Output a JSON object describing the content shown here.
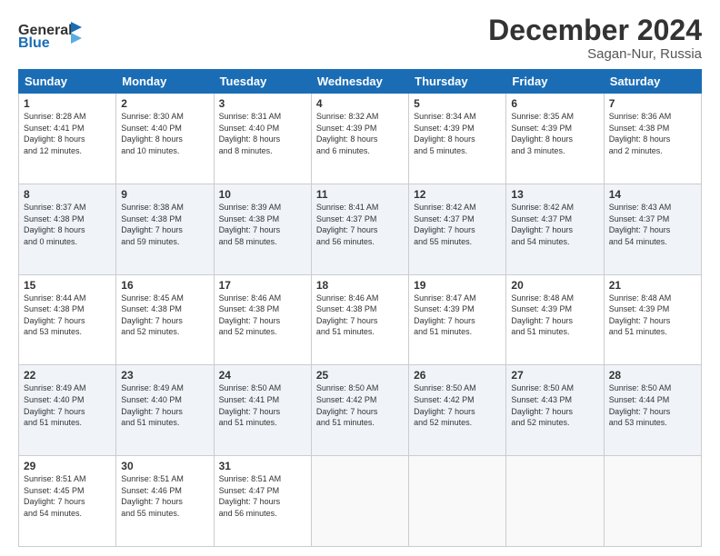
{
  "header": {
    "logo_general": "General",
    "logo_blue": "Blue",
    "month_title": "December 2024",
    "subtitle": "Sagan-Nur, Russia"
  },
  "days_of_week": [
    "Sunday",
    "Monday",
    "Tuesday",
    "Wednesday",
    "Thursday",
    "Friday",
    "Saturday"
  ],
  "weeks": [
    [
      {
        "day": "1",
        "info": "Sunrise: 8:28 AM\nSunset: 4:41 PM\nDaylight: 8 hours\nand 12 minutes."
      },
      {
        "day": "2",
        "info": "Sunrise: 8:30 AM\nSunset: 4:40 PM\nDaylight: 8 hours\nand 10 minutes."
      },
      {
        "day": "3",
        "info": "Sunrise: 8:31 AM\nSunset: 4:40 PM\nDaylight: 8 hours\nand 8 minutes."
      },
      {
        "day": "4",
        "info": "Sunrise: 8:32 AM\nSunset: 4:39 PM\nDaylight: 8 hours\nand 6 minutes."
      },
      {
        "day": "5",
        "info": "Sunrise: 8:34 AM\nSunset: 4:39 PM\nDaylight: 8 hours\nand 5 minutes."
      },
      {
        "day": "6",
        "info": "Sunrise: 8:35 AM\nSunset: 4:39 PM\nDaylight: 8 hours\nand 3 minutes."
      },
      {
        "day": "7",
        "info": "Sunrise: 8:36 AM\nSunset: 4:38 PM\nDaylight: 8 hours\nand 2 minutes."
      }
    ],
    [
      {
        "day": "8",
        "info": "Sunrise: 8:37 AM\nSunset: 4:38 PM\nDaylight: 8 hours\nand 0 minutes."
      },
      {
        "day": "9",
        "info": "Sunrise: 8:38 AM\nSunset: 4:38 PM\nDaylight: 7 hours\nand 59 minutes."
      },
      {
        "day": "10",
        "info": "Sunrise: 8:39 AM\nSunset: 4:38 PM\nDaylight: 7 hours\nand 58 minutes."
      },
      {
        "day": "11",
        "info": "Sunrise: 8:41 AM\nSunset: 4:37 PM\nDaylight: 7 hours\nand 56 minutes."
      },
      {
        "day": "12",
        "info": "Sunrise: 8:42 AM\nSunset: 4:37 PM\nDaylight: 7 hours\nand 55 minutes."
      },
      {
        "day": "13",
        "info": "Sunrise: 8:42 AM\nSunset: 4:37 PM\nDaylight: 7 hours\nand 54 minutes."
      },
      {
        "day": "14",
        "info": "Sunrise: 8:43 AM\nSunset: 4:37 PM\nDaylight: 7 hours\nand 54 minutes."
      }
    ],
    [
      {
        "day": "15",
        "info": "Sunrise: 8:44 AM\nSunset: 4:38 PM\nDaylight: 7 hours\nand 53 minutes."
      },
      {
        "day": "16",
        "info": "Sunrise: 8:45 AM\nSunset: 4:38 PM\nDaylight: 7 hours\nand 52 minutes."
      },
      {
        "day": "17",
        "info": "Sunrise: 8:46 AM\nSunset: 4:38 PM\nDaylight: 7 hours\nand 52 minutes."
      },
      {
        "day": "18",
        "info": "Sunrise: 8:46 AM\nSunset: 4:38 PM\nDaylight: 7 hours\nand 51 minutes."
      },
      {
        "day": "19",
        "info": "Sunrise: 8:47 AM\nSunset: 4:39 PM\nDaylight: 7 hours\nand 51 minutes."
      },
      {
        "day": "20",
        "info": "Sunrise: 8:48 AM\nSunset: 4:39 PM\nDaylight: 7 hours\nand 51 minutes."
      },
      {
        "day": "21",
        "info": "Sunrise: 8:48 AM\nSunset: 4:39 PM\nDaylight: 7 hours\nand 51 minutes."
      }
    ],
    [
      {
        "day": "22",
        "info": "Sunrise: 8:49 AM\nSunset: 4:40 PM\nDaylight: 7 hours\nand 51 minutes."
      },
      {
        "day": "23",
        "info": "Sunrise: 8:49 AM\nSunset: 4:40 PM\nDaylight: 7 hours\nand 51 minutes."
      },
      {
        "day": "24",
        "info": "Sunrise: 8:50 AM\nSunset: 4:41 PM\nDaylight: 7 hours\nand 51 minutes."
      },
      {
        "day": "25",
        "info": "Sunrise: 8:50 AM\nSunset: 4:42 PM\nDaylight: 7 hours\nand 51 minutes."
      },
      {
        "day": "26",
        "info": "Sunrise: 8:50 AM\nSunset: 4:42 PM\nDaylight: 7 hours\nand 52 minutes."
      },
      {
        "day": "27",
        "info": "Sunrise: 8:50 AM\nSunset: 4:43 PM\nDaylight: 7 hours\nand 52 minutes."
      },
      {
        "day": "28",
        "info": "Sunrise: 8:50 AM\nSunset: 4:44 PM\nDaylight: 7 hours\nand 53 minutes."
      }
    ],
    [
      {
        "day": "29",
        "info": "Sunrise: 8:51 AM\nSunset: 4:45 PM\nDaylight: 7 hours\nand 54 minutes."
      },
      {
        "day": "30",
        "info": "Sunrise: 8:51 AM\nSunset: 4:46 PM\nDaylight: 7 hours\nand 55 minutes."
      },
      {
        "day": "31",
        "info": "Sunrise: 8:51 AM\nSunset: 4:47 PM\nDaylight: 7 hours\nand 56 minutes."
      },
      {
        "day": "",
        "info": ""
      },
      {
        "day": "",
        "info": ""
      },
      {
        "day": "",
        "info": ""
      },
      {
        "day": "",
        "info": ""
      }
    ]
  ]
}
